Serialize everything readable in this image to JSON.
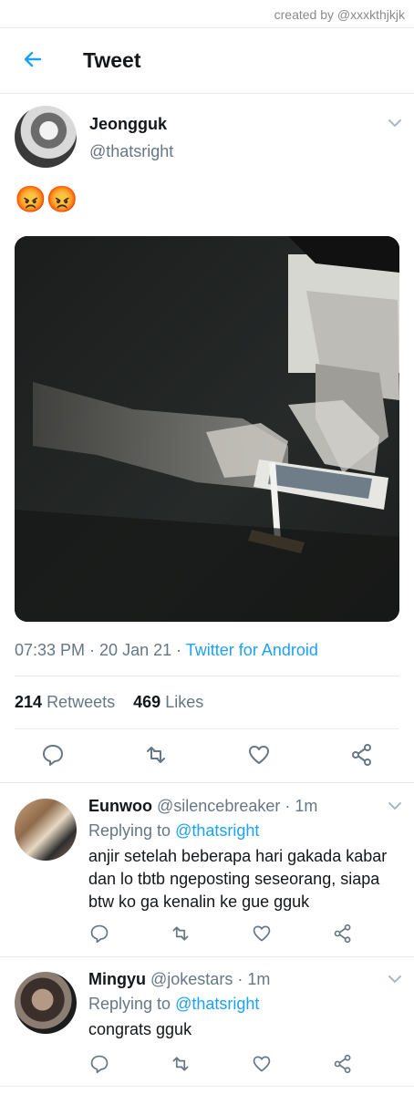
{
  "watermark": "created by @xxxkthjkjk",
  "header": {
    "title": "Tweet"
  },
  "tweet": {
    "name": "Jeongguk",
    "handle": "@thatsright",
    "text": "😡😡",
    "time": "07:33 PM",
    "date": "20 Jan 21",
    "source": "Twitter for Android",
    "retweets": "214",
    "retweets_label": "Retweets",
    "likes": "469",
    "likes_label": "Likes"
  },
  "replies": [
    {
      "name": "Eunwoo",
      "handle": "@silencebreaker",
      "time": "1m",
      "replying_label": "Replying to",
      "replying_to": "@thatsright",
      "lines": [
        "anjir setelah beberapa hari gakada kabar",
        "dan lo tbtb ngeposting seseorang, siapa",
        "btw ko ga kenalin ke gue gguk"
      ]
    },
    {
      "name": "Mingyu",
      "handle": "@jokestars",
      "time": "1m",
      "replying_label": "Replying to",
      "replying_to": "@thatsright",
      "lines": [
        "congrats gguk"
      ]
    }
  ],
  "colors": {
    "accent": "#1da1f2",
    "secondary": "#657786",
    "divider": "#e6ecf0"
  }
}
